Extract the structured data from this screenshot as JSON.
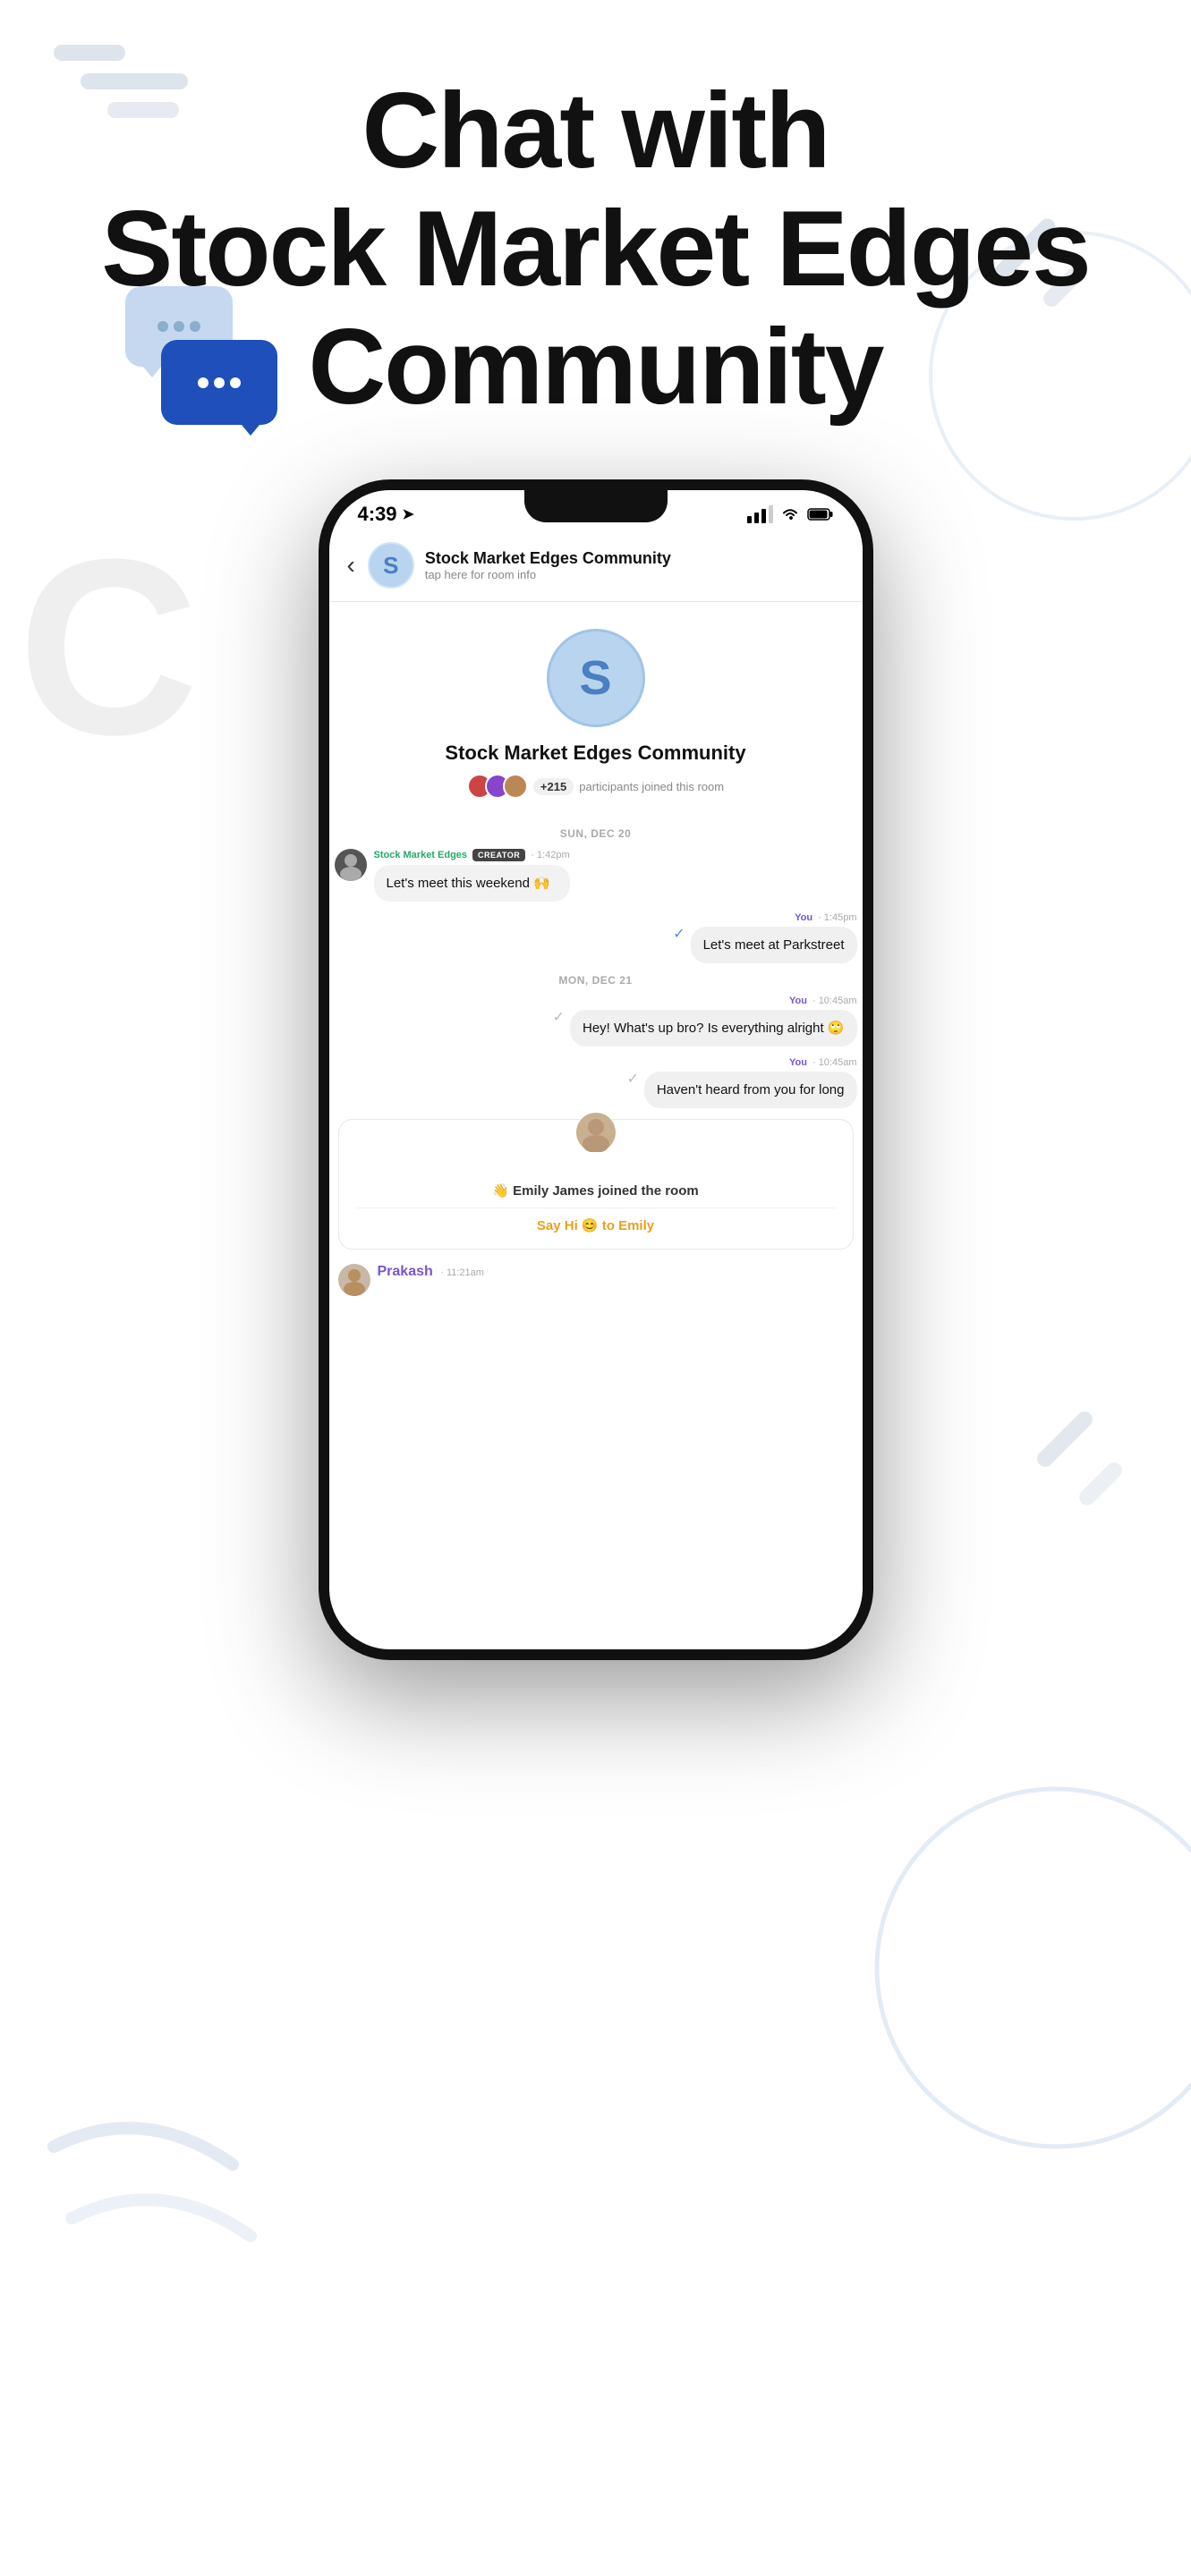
{
  "header": {
    "title_line1": "Chat with",
    "title_line2": "Stock Market Edges",
    "title_line3": "Community"
  },
  "phone": {
    "status_bar": {
      "time": "4:39",
      "location_icon": "▸"
    },
    "chat_header": {
      "back": "‹",
      "room_initial": "S",
      "room_name": "Stock Market Edges Community",
      "room_subtitle": "tap here for room info"
    },
    "room_info": {
      "initial": "S",
      "name": "Stock Market Edges Community",
      "participant_count": "+215",
      "participant_text": "participants joined this room"
    },
    "date_dividers": {
      "first": "SUN, DEC 20",
      "second": "MON, DEC 21"
    },
    "messages": [
      {
        "id": "msg1",
        "type": "received",
        "sender_name": "Stock Market Edges",
        "sender_color": "green",
        "badge": "CREATOR",
        "time": "1:42pm",
        "text": "Let's meet this weekend 🙌"
      },
      {
        "id": "msg2",
        "type": "sent",
        "sender_name": "You",
        "time": "1:45pm",
        "text": "Let's meet at Parkstreet",
        "check": "✓"
      },
      {
        "id": "msg3",
        "type": "sent",
        "sender_name": "You",
        "time": "10:45am",
        "text": "Hey! What's up bro? Is everything alright 🙄",
        "check": "✓"
      },
      {
        "id": "msg4",
        "type": "sent",
        "sender_name": "You",
        "time": "10:45am",
        "text": "Haven't heard from you for long",
        "check": "✓"
      }
    ],
    "join_notification": {
      "wave": "👋",
      "name": "Emily James",
      "joined_text": "joined the room",
      "say_hi_text": "Say Hi 😊 to Emily"
    },
    "prakash_message": {
      "name": "Prakash",
      "time": "11:21am"
    }
  }
}
